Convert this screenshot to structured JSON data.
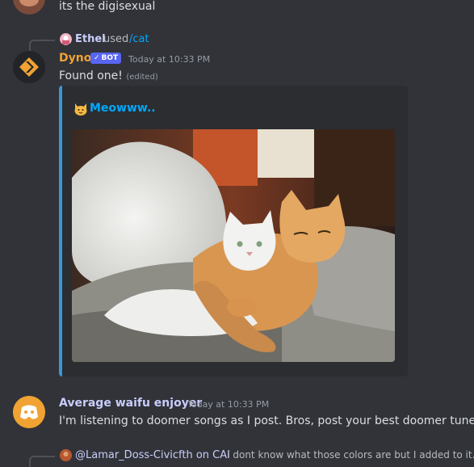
{
  "prev_message": {
    "text": "its the digisexual"
  },
  "dyno_message": {
    "reply": {
      "user": "Ethel",
      "used": "used",
      "command": "/cat"
    },
    "author": {
      "name": "Dyno",
      "tag": "BOT",
      "color": "#f0a232"
    },
    "timestamp": "Today at 10:33 PM",
    "text": "Found one!",
    "edited": "(edited)",
    "embed": {
      "title": "Meowww..",
      "accent": "#3498db",
      "title_emoji": "cat-face-icon"
    }
  },
  "waifu_message": {
    "author": {
      "name": "Average waifu enjoyer",
      "color": "#c9cdfb"
    },
    "timestamp": "Today at 10:33 PM",
    "text": "I'm listening to doomer songs as I post. Bros, post your best doomer tunes"
  },
  "next_message": {
    "reply": {
      "mention": "@Lamar_Doss-Civicfth on CAI",
      "text": "I dont know what those colors are but I added to it. i"
    }
  }
}
